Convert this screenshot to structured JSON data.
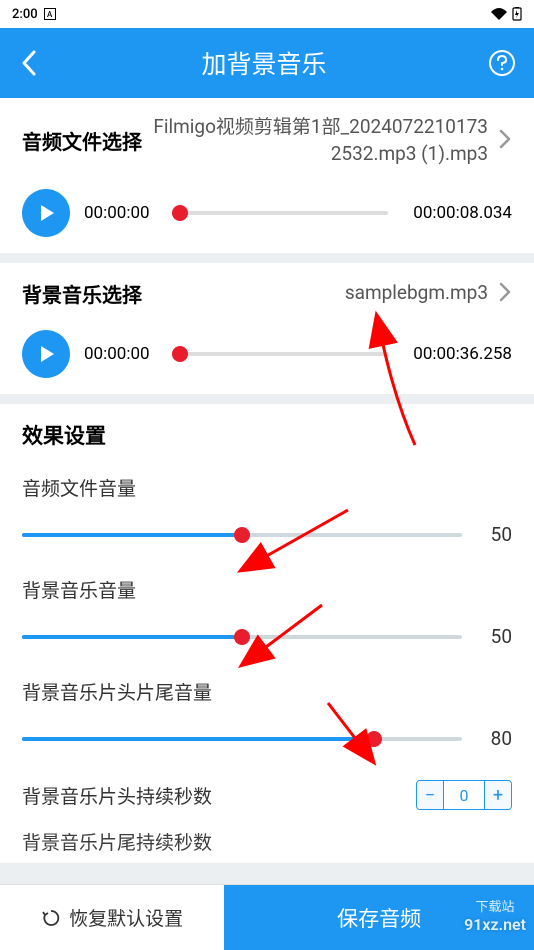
{
  "status": {
    "time": "2:00"
  },
  "titlebar": {
    "title": "加背景音乐"
  },
  "audio_file": {
    "label": "音频文件选择",
    "name": "Filmigo视频剪辑第1部_20240722101732532.mp3 (1).mp3",
    "current": "00:00:00",
    "duration": "00:00:08.034",
    "seek_pct": 0
  },
  "bgm_file": {
    "label": "背景音乐选择",
    "name": "samplebgm.mp3",
    "current": "00:00:00",
    "duration": "00:00:36.258",
    "seek_pct": 0
  },
  "effects": {
    "title": "效果设置",
    "sliders": [
      {
        "label": "音频文件音量",
        "value": 50,
        "pct": 50
      },
      {
        "label": "背景音乐音量",
        "value": 50,
        "pct": 50
      },
      {
        "label": "背景音乐片头片尾音量",
        "value": 80,
        "pct": 80
      }
    ],
    "stepper1": {
      "label": "背景音乐片头持续秒数",
      "value": 0
    },
    "stepper2_label": "背景音乐片尾持续秒数"
  },
  "bottom": {
    "restore": "恢复默认设置",
    "save": "保存音频"
  },
  "watermark": {
    "top": "下载站",
    "bottom": "91xz.net"
  },
  "icons": {
    "minus": "−",
    "plus": "+"
  }
}
